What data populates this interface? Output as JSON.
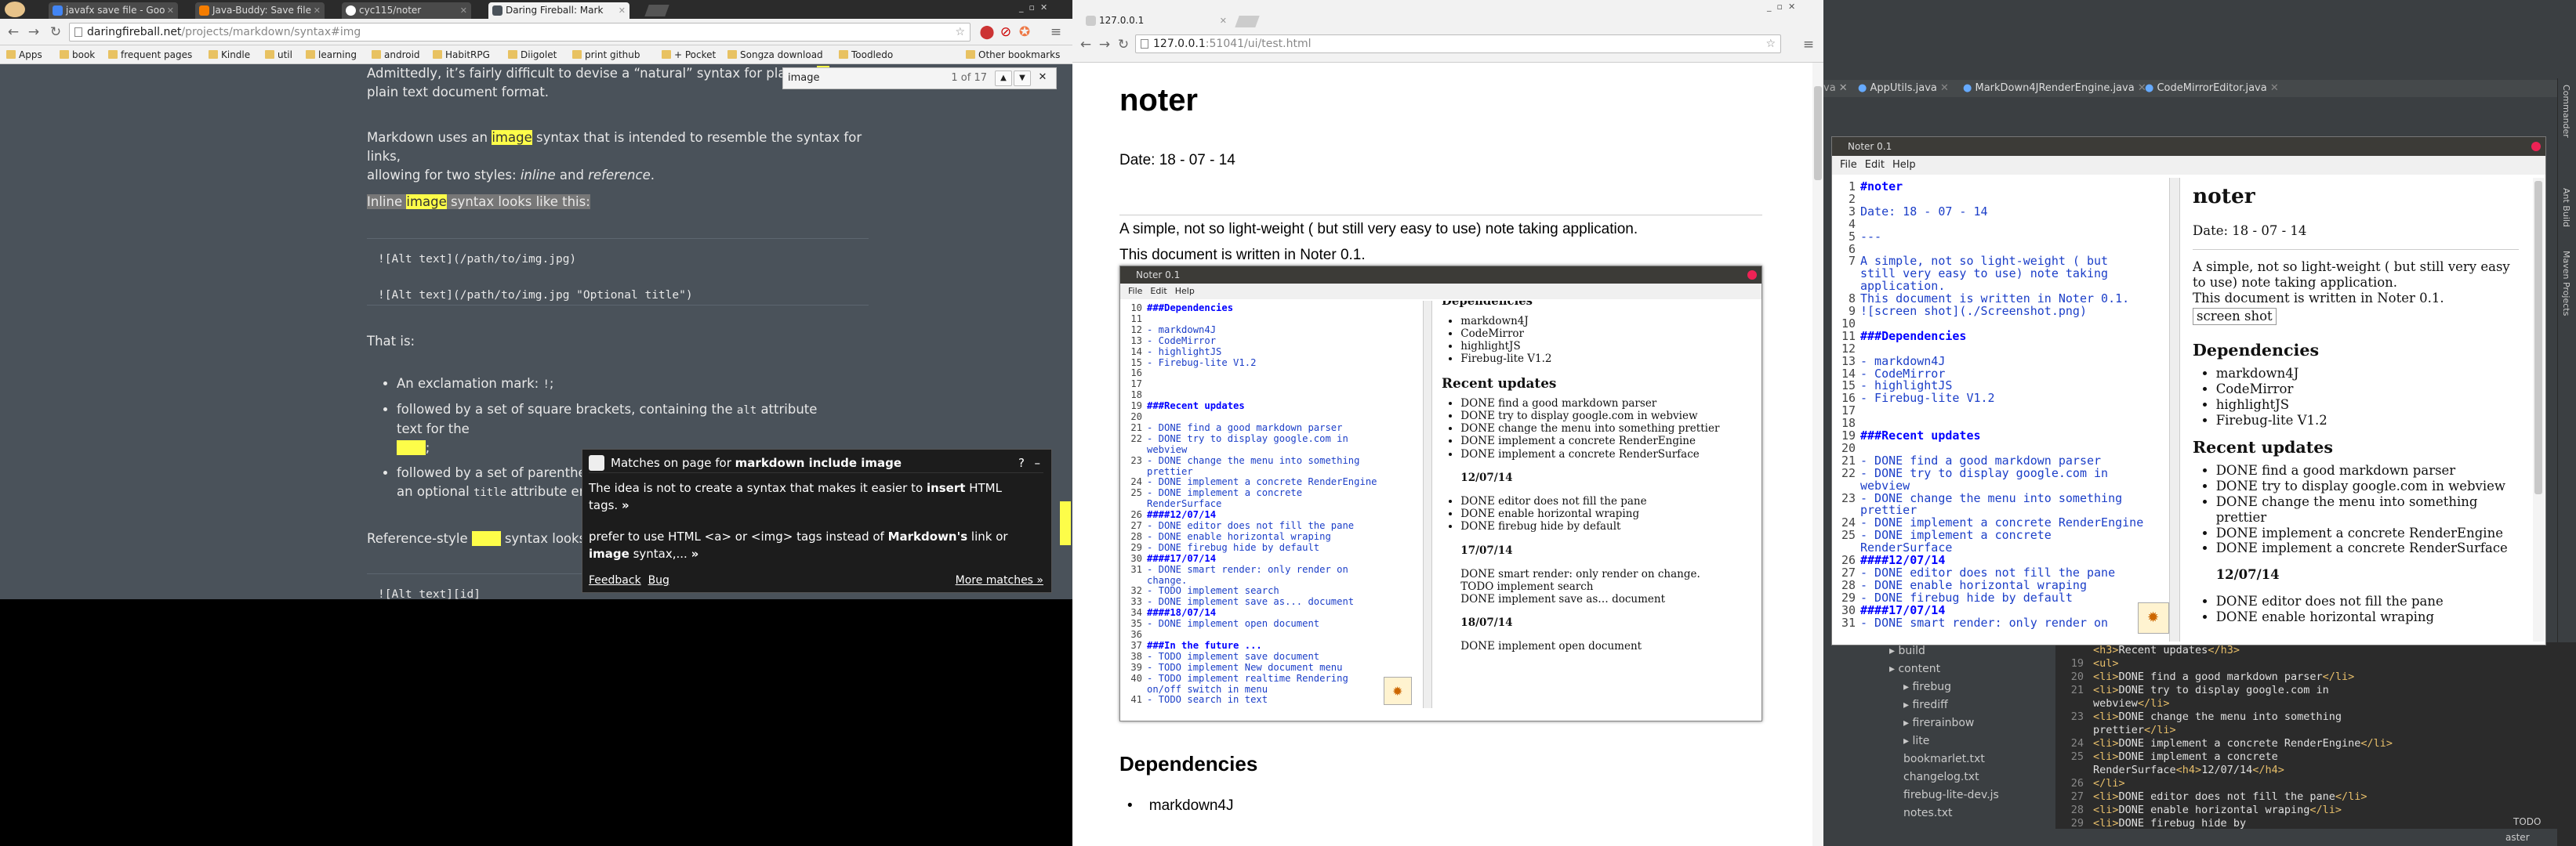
{
  "browser_left": {
    "tabs": [
      "javafx save file - Goo",
      "Java-Buddy: Save file",
      "cyc115/noter",
      "Daring Fireball: Mark"
    ],
    "url_host": "daringfireball.net",
    "url_path": "/projects/markdown/syntax#img",
    "bookmarks": [
      "Apps",
      "book",
      "frequent pages",
      "Kindle",
      "util",
      "learning",
      "android",
      "HabitRPG",
      "Diigolet",
      "print github",
      "+ Pocket",
      "Songza download",
      "Toodledo",
      "Other bookmarks"
    ],
    "find": {
      "query": "image",
      "count": "1 of 17"
    },
    "page": {
      "p1a": "Admittedly, it’s fairly difficult to devise a “natural” syntax for placing",
      "p1b": "plain text document format.",
      "p2a": "Markdown uses an",
      "p2hl": "image",
      "p2b": "syntax that is intended to resemble the syntax for links,",
      "p2c": "allowing for two styles:",
      "p2i1": "inline",
      "p2and": "and",
      "p2i2": "reference",
      "p3a": "Inline",
      "p3hl": "image",
      "p3b": "syntax looks like this:",
      "code1": "![Alt text](/path/to/img.jpg)",
      "code2": "![Alt text](/path/to/img.jpg \"Optional title\")",
      "that_is": "That is:",
      "li1a": "An exclamation mark:",
      "li1b": "!",
      "li2a": "followed by a set of square brackets, containing the",
      "li2c": "alt",
      "li2b": "attribute text for the",
      "li3a": "followed by a set of parenthese",
      "li3b": "an optional",
      "li3c": "title",
      "li3d": "attribute enclo",
      "p4a": "Reference-style",
      "p4b": "syntax looks",
      "code3": "![Alt text][id]"
    },
    "popup": {
      "header_pre": "Matches on page for",
      "header_q": "markdown include image",
      "r1a": "The idea is not to create a syntax that makes it easier to",
      "r1b": "insert",
      "r1c": "HTML",
      "r1d": "tags.",
      "r2a": "prefer to use HTML <a> or <img> tags instead of",
      "r2b": "Markdown's",
      "r2c": "link or",
      "r2d": "image",
      "r2e": "syntax,...",
      "feedback": "Feedback",
      "bug": "Bug",
      "more": "More matches »"
    }
  },
  "browser_mid": {
    "url_host": "127.0.0.1",
    "url_path": ":51041/ui/test.html",
    "h1": "noter",
    "date": "Date: 18 - 07 - 14",
    "intro1": "A simple, not so light-weight ( but still very easy to use) note taking application.",
    "intro2": "This document is written in Noter 0.1.",
    "h2": "Dependencies",
    "li1": "markdown4J"
  },
  "noter_shot": {
    "title": "Noter 0.1",
    "menu": [
      "File",
      "Edit",
      "Help"
    ],
    "lines": [
      [
        "10",
        "###Dependencies"
      ],
      [
        "11",
        ""
      ],
      [
        "12",
        "- markdown4J"
      ],
      [
        "13",
        "- CodeMirror"
      ],
      [
        "14",
        "- highlightJS"
      ],
      [
        "15",
        "- Firebug-lite V1.2"
      ],
      [
        "16",
        ""
      ],
      [
        "17",
        ""
      ],
      [
        "18",
        ""
      ],
      [
        "19",
        "###Recent updates"
      ],
      [
        "20",
        ""
      ],
      [
        "21",
        "- DONE find a good markdown parser"
      ],
      [
        "22",
        "- DONE try to display google.com in"
      ],
      [
        "",
        "webview"
      ],
      [
        "23",
        "- DONE change the menu into something"
      ],
      [
        "",
        "prettier"
      ],
      [
        "24",
        "- DONE implement a concrete RenderEngine"
      ],
      [
        "25",
        "- DONE implement a concrete"
      ],
      [
        "",
        "RenderSurface"
      ],
      [
        "26",
        "####12/07/14"
      ],
      [
        "27",
        "- DONE editor does not fill the pane"
      ],
      [
        "28",
        "- DONE enable horizontal wraping"
      ],
      [
        "29",
        "- DONE firebug hide by default"
      ],
      [
        "30",
        "####17/07/14"
      ],
      [
        "31",
        "- DONE smart render: only render on"
      ],
      [
        "",
        "change."
      ],
      [
        "32",
        "- TODO implement search"
      ],
      [
        "33",
        "- DONE implement save as... document"
      ],
      [
        "34",
        "####18/07/14"
      ],
      [
        "35",
        "- DONE implement open document"
      ],
      [
        "36",
        ""
      ],
      [
        "37",
        "###In the future ..."
      ],
      [
        "38",
        "- TODO implement save document"
      ],
      [
        "39",
        "- TODO implement New document menu"
      ],
      [
        "40",
        "- TODO implement realtime Rendering"
      ],
      [
        "",
        "on/off switch in menu"
      ],
      [
        "41",
        "- TODO search in text"
      ]
    ],
    "preview": {
      "h_cut": "Dependencies",
      "deps": [
        "markdown4J",
        "CodeMirror",
        "highlightJS",
        "Firebug-lite V1.2"
      ],
      "h_recent": "Recent updates",
      "recent": [
        "DONE find a good markdown parser",
        "DONE try to display google.com in webview",
        "DONE change the menu into something prettier",
        "DONE implement a concrete RenderEngine",
        "DONE implement a concrete RenderSurface"
      ],
      "d1": "12/07/14",
      "g1": [
        "DONE editor does not fill the pane",
        "DONE enable horizontal wraping",
        "DONE firebug hide by default"
      ],
      "d2": "17/07/14",
      "g2": [
        "DONE smart render: only render on change.",
        "TODO implement search",
        "DONE implement save as… document"
      ],
      "d3": "18/07/14",
      "g3": [
        "DONE implement open document"
      ]
    }
  },
  "ide": {
    "tabs": [
      "AppUtils.java",
      "MarkDown4JRenderEngine.java",
      "CodeMirrorEditor.java"
    ],
    "side_tabs": [
      "Commander",
      "Ant Build",
      "Maven Projects"
    ],
    "tree": [
      "build",
      "content",
      "firebug",
      "firediff",
      "firerainbow",
      "lite",
      "bookmarlet.txt",
      "changelog.txt",
      "firebug-lite-dev.js",
      "notes.txt"
    ],
    "code_lines": [
      [
        "",
        "<h3>Recent updates</h3>"
      ],
      [
        "19",
        "<ul>"
      ],
      [
        "20",
        "<li>DONE find a good markdown parser</li>"
      ],
      [
        "21",
        "<li>DONE try to display google.com in"
      ],
      [
        "",
        "webview</li>"
      ],
      [
        "23",
        "<li>DONE change the menu into something"
      ],
      [
        "",
        "prettier</li>"
      ],
      [
        "24",
        "<li>DONE implement a concrete RenderEngine</li>"
      ],
      [
        "25",
        "<li>DONE implement a concrete"
      ],
      [
        "",
        "RenderSurface<h4>12/07/14</h4>"
      ],
      [
        "26",
        "</li>"
      ],
      [
        "27",
        "<li>DONE editor does not fill the pane</li>"
      ],
      [
        "28",
        "<li>DONE enable horizontal wraping</li>"
      ],
      [
        "29",
        "<li>DONE firebug hide by"
      ]
    ],
    "status": [
      "aster",
      "TODO"
    ]
  },
  "noter_window": {
    "title": "Noter 0.1",
    "menu": [
      "File",
      "Edit",
      "Help"
    ],
    "lines": [
      [
        "1",
        "#noter"
      ],
      [
        "2",
        ""
      ],
      [
        "3",
        "Date: 18 - 07 - 14"
      ],
      [
        "4",
        ""
      ],
      [
        "5",
        "---"
      ],
      [
        "6",
        ""
      ],
      [
        "7",
        "A simple, not so light-weight ( but"
      ],
      [
        "",
        "still very easy to use) note taking"
      ],
      [
        "",
        "application."
      ],
      [
        "8",
        "This document is written in Noter 0.1."
      ],
      [
        "9",
        "![screen shot](./Screenshot.png)"
      ],
      [
        "10",
        ""
      ],
      [
        "11",
        "###Dependencies"
      ],
      [
        "12",
        ""
      ],
      [
        "13",
        "- markdown4J"
      ],
      [
        "14",
        "- CodeMirror"
      ],
      [
        "15",
        "- highlightJS"
      ],
      [
        "16",
        "- Firebug-lite V1.2"
      ],
      [
        "17",
        ""
      ],
      [
        "18",
        ""
      ],
      [
        "19",
        "###Recent updates"
      ],
      [
        "20",
        ""
      ],
      [
        "21",
        "- DONE find a good markdown parser"
      ],
      [
        "22",
        "- DONE try to display google.com in"
      ],
      [
        "",
        "webview"
      ],
      [
        "23",
        "- DONE change the menu into something"
      ],
      [
        "",
        "prettier"
      ],
      [
        "24",
        "- DONE implement a concrete RenderEngine"
      ],
      [
        "25",
        "- DONE implement a concrete"
      ],
      [
        "",
        "RenderSurface"
      ],
      [
        "26",
        "####12/07/14"
      ],
      [
        "27",
        "- DONE editor does not fill the pane"
      ],
      [
        "28",
        "- DONE enable horizontal wraping"
      ],
      [
        "29",
        "- DONE firebug hide by default"
      ],
      [
        "30",
        "####17/07/14"
      ],
      [
        "31",
        "- DONE smart render: only render on"
      ]
    ],
    "preview": {
      "h1": "noter",
      "date": "Date: 18 - 07 - 14",
      "intro": "A simple, not so light-weight ( but still very easy to use) note taking application.",
      "intro2": "This document is written in Noter 0.1.",
      "btn": "screen shot",
      "h2": "Dependencies",
      "deps": [
        "markdown4J",
        "CodeMirror",
        "highlightJS",
        "Firebug-lite V1.2"
      ],
      "h3": "Recent updates",
      "recent": [
        "DONE find a good markdown parser",
        "DONE try to display google.com in webview",
        "DONE change the menu into something prettier",
        "DONE implement a concrete RenderEngine",
        "DONE implement a concrete RenderSurface"
      ],
      "d1": "12/07/14",
      "g1": [
        "DONE editor does not fill the pane",
        "DONE enable horizontal wraping"
      ]
    }
  }
}
